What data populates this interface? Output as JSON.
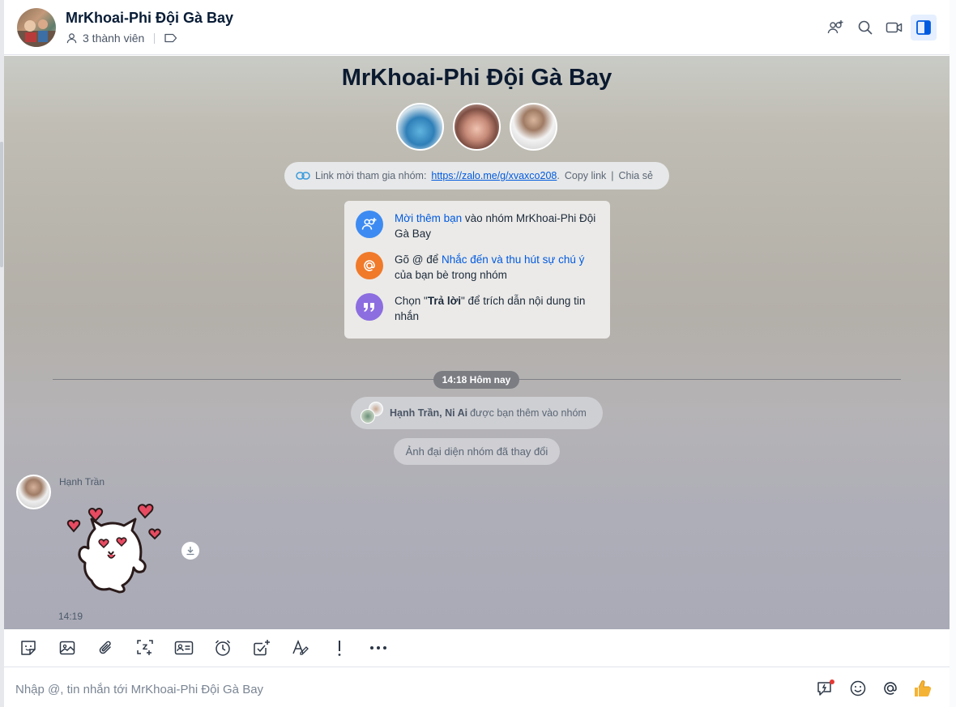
{
  "header": {
    "title": "MrKhoai-Phi Đội Gà Bay",
    "member_count": "3 thành viên"
  },
  "chat": {
    "group_name": "MrKhoai-Phi Đội Gà Bay",
    "invite": {
      "label": "Link mời tham gia nhóm:",
      "url": "https://zalo.me/g/xvaxco208",
      "copy": "Copy link",
      "sep": "|",
      "share": "Chia sẻ"
    },
    "tips": [
      {
        "highlight": "Mời thêm bạn",
        "rest": " vào nhóm MrKhoai-Phi Đội Gà Bay"
      },
      {
        "before": "Gõ @ để ",
        "highlight": "Nhắc đến và thu hút sự chú ý",
        "rest": " của bạn bè trong nhóm"
      },
      {
        "before": "Chọn \"",
        "bold": "Trả lời",
        "rest": "\" để trích dẫn nội dung tin nhắn"
      }
    ],
    "time_divider": "14:18 Hôm nay",
    "system_added": {
      "names": "Hạnh Trần, Ni Ai",
      "text": "được bạn thêm vào nhóm"
    },
    "system_avatar": "Ảnh đại diện nhóm đã thay đổi",
    "message": {
      "sender": "Hạnh Trần",
      "time": "14:19"
    }
  },
  "input": {
    "placeholder": "Nhập @, tin nhắn tới MrKhoai-Phi Đội Gà Bay"
  },
  "colors": {
    "accent": "#005ae0",
    "tip_add": "#3d8bf2",
    "tip_mention": "#f07a2a",
    "tip_reply": "#8c6ee0",
    "like": "#f5b335"
  }
}
